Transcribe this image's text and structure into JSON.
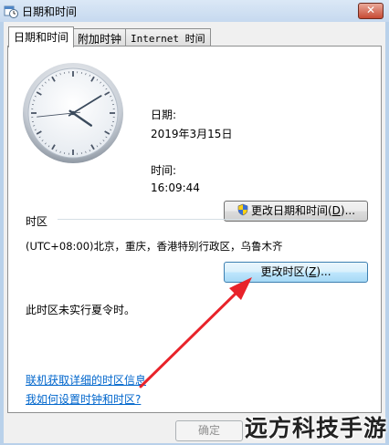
{
  "window": {
    "title": "日期和时间",
    "close_glyph": "✕",
    "icon": "clock-calendar-icon"
  },
  "tabs": [
    {
      "label": "日期和时间",
      "active": true
    },
    {
      "label": "附加时钟",
      "active": false
    },
    {
      "label": "Internet 时间",
      "active": false
    }
  ],
  "datetime": {
    "date_label": "日期:",
    "date_value": "2019年3月15日",
    "time_label": "时间:",
    "time_value": "16:09:44",
    "change_button": {
      "text": "更改日期和时间(",
      "mnemonic": "D",
      "suffix": ")..."
    }
  },
  "timezone": {
    "section_label": "时区",
    "value": "(UTC+08:00)北京，重庆，香港特别行政区，乌鲁木齐",
    "change_button": {
      "text": "更改时区(",
      "mnemonic": "Z",
      "suffix": ")..."
    },
    "dst_note": "此时区未实行夏令时。"
  },
  "links": {
    "timezone_info": "联机获取详细的时区信息",
    "how_to": "我如何设置时钟和时区?"
  },
  "footer": {
    "ok_label": "确定",
    "ok_enabled": false
  },
  "watermark": "远方科技手游",
  "colors": {
    "link": "#0066cc",
    "arrow": "#e8232a",
    "close_button": "#c74a33"
  }
}
